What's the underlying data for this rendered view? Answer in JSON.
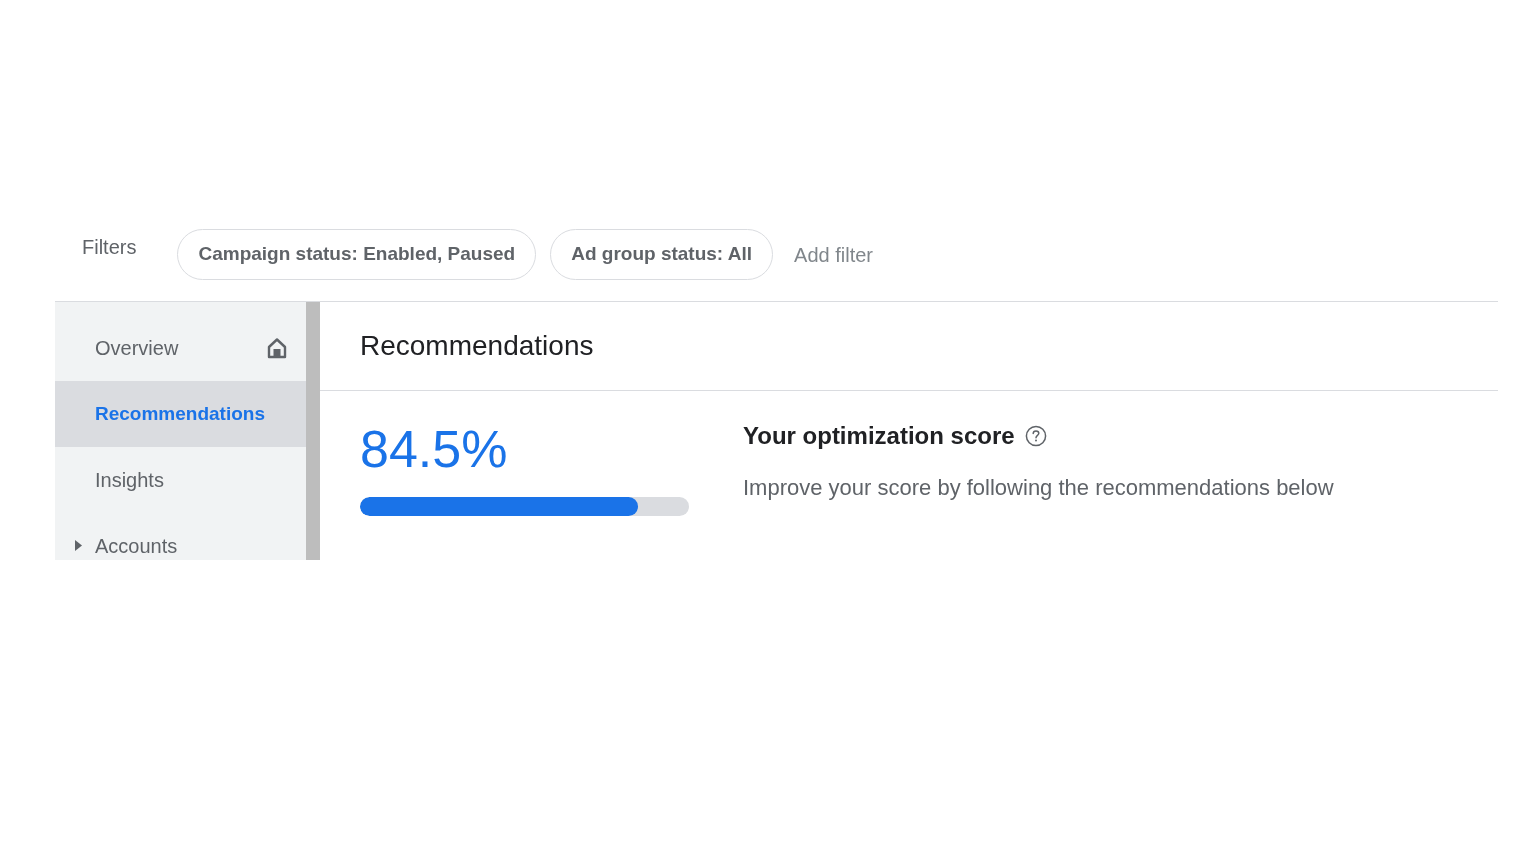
{
  "filters": {
    "label": "Filters",
    "chips": [
      "Campaign status: Enabled, Paused",
      "Ad group status: All"
    ],
    "add_filter": "Add filter"
  },
  "sidebar": {
    "items": [
      {
        "label": "Overview",
        "kind": "home",
        "selected": false
      },
      {
        "label": "Recommendations",
        "kind": "plain",
        "selected": true
      },
      {
        "label": "Insights",
        "kind": "plain",
        "selected": false
      },
      {
        "label": "Accounts",
        "kind": "expandable",
        "selected": false,
        "expanded": false
      }
    ]
  },
  "main": {
    "title": "Recommendations",
    "score": {
      "value": "84.5%",
      "level": 0.845
    },
    "heading": "Your optimization score",
    "description": "Improve your score by following the recommendations below"
  }
}
